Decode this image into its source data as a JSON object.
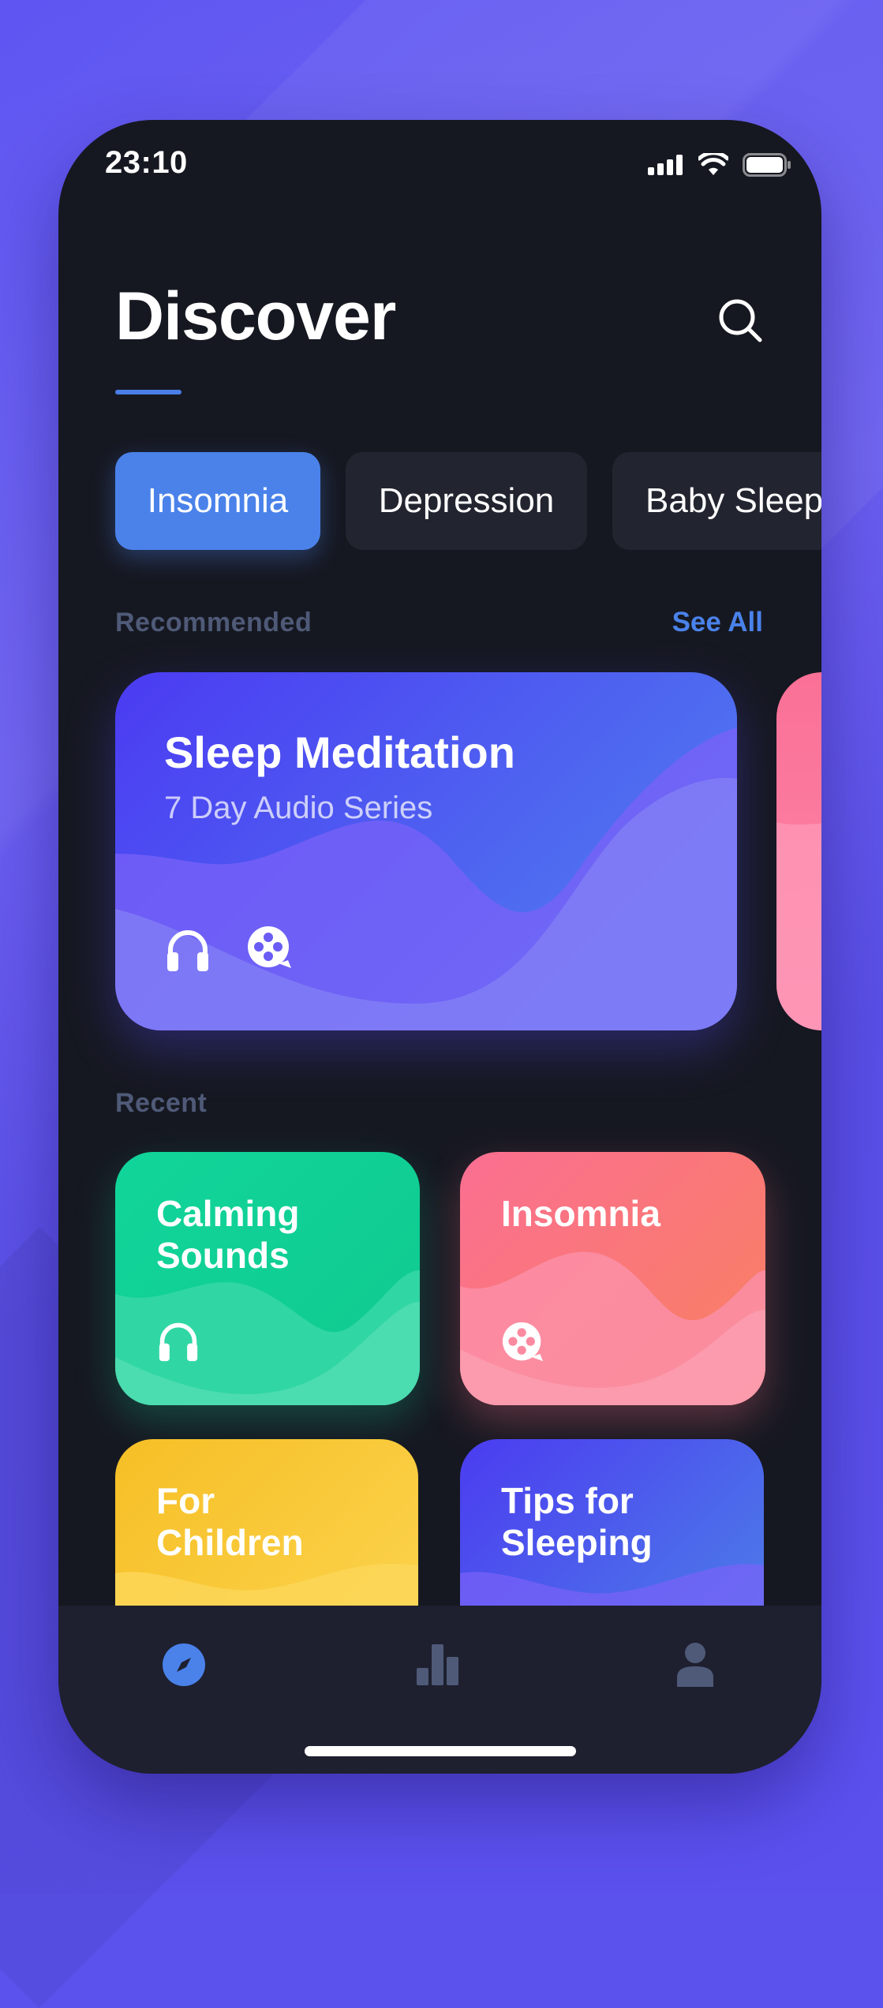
{
  "status_bar": {
    "time": "23:10",
    "icons": [
      "signal-icon",
      "wifi-icon",
      "battery-icon"
    ]
  },
  "header": {
    "title": "Discover",
    "search_icon": "search-icon"
  },
  "categories": [
    {
      "label": "Insomnia",
      "active": true
    },
    {
      "label": "Depression",
      "active": false
    },
    {
      "label": "Baby Sleep",
      "active": false
    }
  ],
  "recommended": {
    "label": "Recommended",
    "see_all": "See All",
    "featured": {
      "title": "Sleep Meditation",
      "subtitle": "7 Day Audio Series",
      "icons": [
        "headphones-icon",
        "film-reel-icon"
      ]
    }
  },
  "recent": {
    "label": "Recent",
    "items": [
      {
        "title": "Calming\nSounds",
        "icon": "headphones-icon",
        "color": "#13d39a"
      },
      {
        "title": "Insomnia",
        "icon": "film-reel-icon",
        "color": "#fb7185"
      },
      {
        "title": "For\nChildren",
        "icon": "",
        "color": "#fbbf24"
      },
      {
        "title": "Tips for\nSleeping",
        "icon": "",
        "color": "#4f46e5"
      }
    ]
  },
  "tab_bar": {
    "items": [
      {
        "name": "discover-tab",
        "icon": "compass-icon",
        "active": true
      },
      {
        "name": "stats-tab",
        "icon": "bar-chart-icon",
        "active": false
      },
      {
        "name": "profile-tab",
        "icon": "user-icon",
        "active": false
      }
    ]
  },
  "colors": {
    "background": "#5b52ee",
    "phone": "#161821",
    "accent": "#4a82ea",
    "chip_inactive": "#22242f",
    "tab_bar": "#1e2030",
    "muted_text": "#4f5a78"
  }
}
